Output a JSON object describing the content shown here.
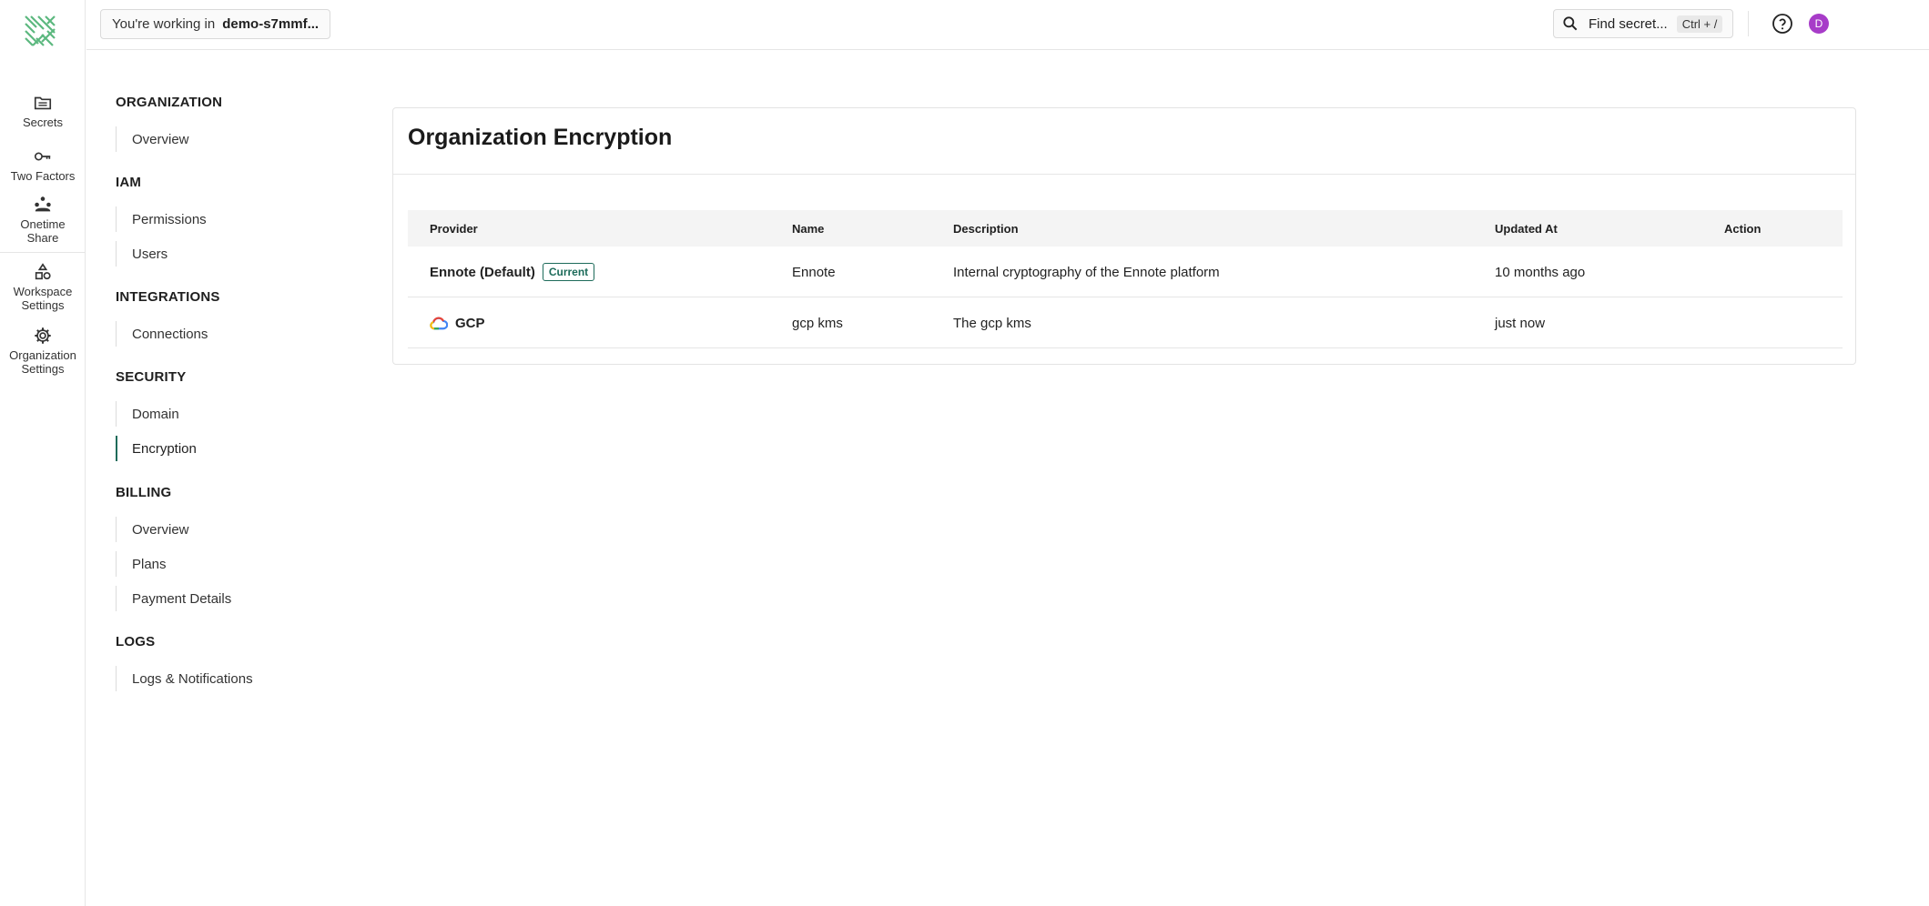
{
  "rail": {
    "items": [
      {
        "label": "Secrets",
        "icon": "folder-icon"
      },
      {
        "label": "Two Factors",
        "icon": "key-icon"
      },
      {
        "label": "Onetime Share",
        "icon": "share-nodes-icon"
      },
      {
        "label": "Workspace Settings",
        "icon": "shapes-icon"
      },
      {
        "label": "Organization Settings",
        "icon": "gear-icon"
      }
    ]
  },
  "topbar": {
    "workspace_prefix": "You're working in",
    "workspace_name": "demo-s7mmf...",
    "search_label": "Find secret...",
    "search_shortcut": "Ctrl + /",
    "avatar_initial": "D"
  },
  "settings_nav": {
    "sections": [
      {
        "title": "ORGANIZATION",
        "items": [
          "Overview"
        ]
      },
      {
        "title": "IAM",
        "items": [
          "Permissions",
          "Users"
        ]
      },
      {
        "title": "INTEGRATIONS",
        "items": [
          "Connections"
        ]
      },
      {
        "title": "SECURITY",
        "items": [
          "Domain",
          "Encryption"
        ]
      },
      {
        "title": "BILLING",
        "items": [
          "Overview",
          "Plans",
          "Payment Details"
        ]
      },
      {
        "title": "LOGS",
        "items": [
          "Logs & Notifications"
        ]
      }
    ],
    "active": "Encryption"
  },
  "main": {
    "title": "Organization Encryption",
    "columns": [
      "Provider",
      "Name",
      "Description",
      "Updated At",
      "Action"
    ],
    "rows": [
      {
        "provider": "Ennote (Default)",
        "badge": "Current",
        "name": "Ennote",
        "description": "Internal cryptography of the Ennote platform",
        "updated": "10 months ago",
        "action": ""
      },
      {
        "provider": "GCP",
        "name": "gcp kms",
        "description": "The gcp kms",
        "updated": "just now",
        "action": ""
      }
    ]
  },
  "colors": {
    "accent": "#1d6b5a",
    "avatar": "#a73cc8",
    "logo": "#4caf78"
  }
}
